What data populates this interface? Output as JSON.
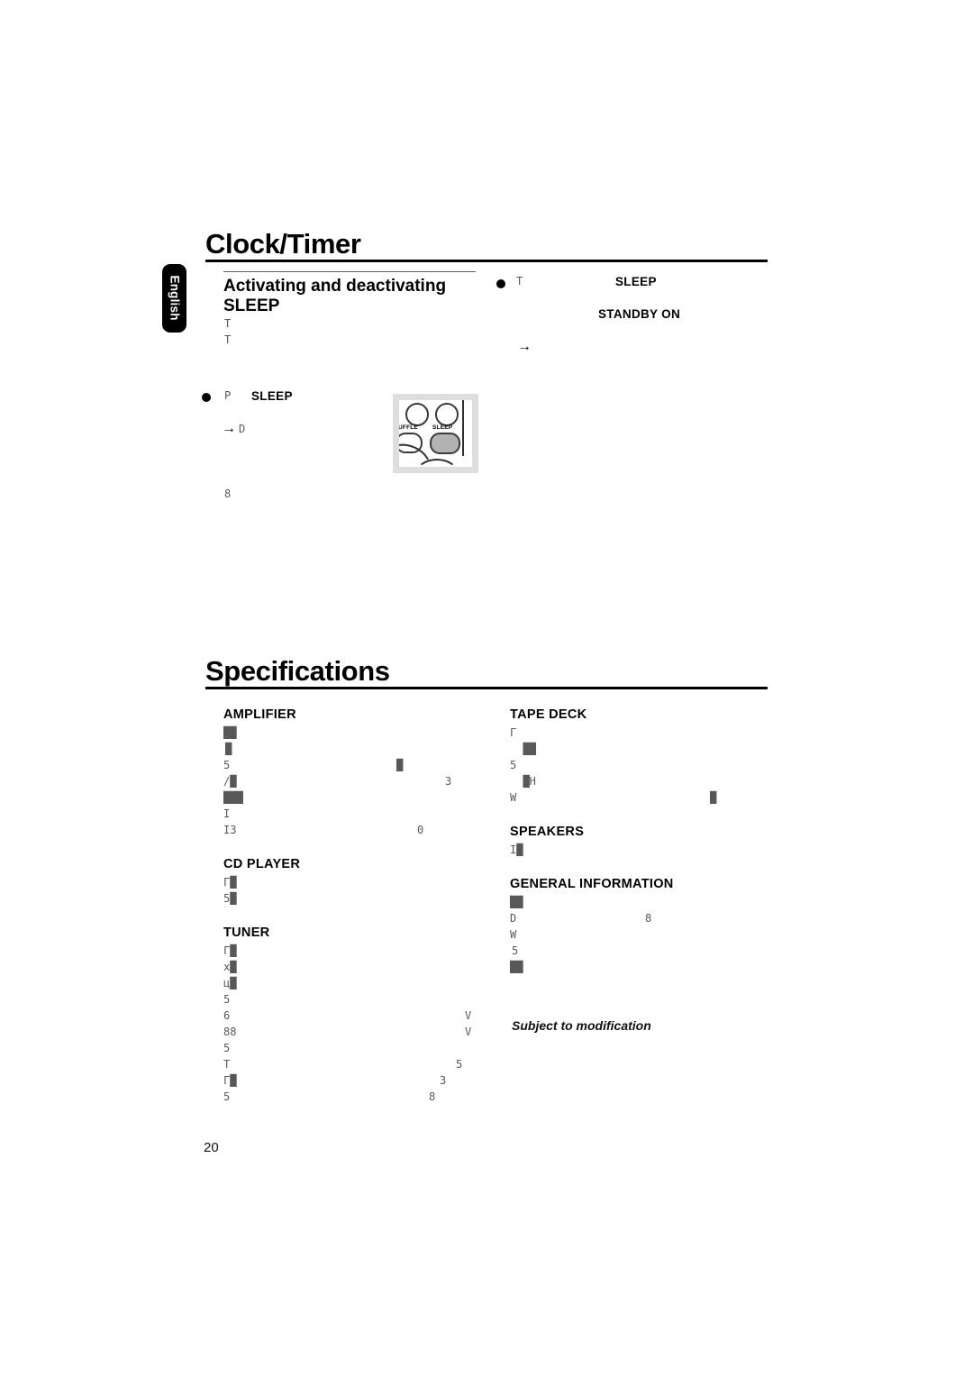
{
  "page": {
    "number": "20",
    "language_tab": "English"
  },
  "chapters": [
    {
      "title": "Clock/Timer"
    },
    {
      "title": "Specifications"
    }
  ],
  "clock_timer": {
    "section_heading_line1": "Activating and deactivating",
    "section_heading_line2": "SLEEP",
    "body_fragments_left": [
      "T",
      "T"
    ],
    "bullets": [
      {
        "glyph": "P",
        "bold_label": "SLEEP",
        "sub_arrow": "→",
        "sub_fragment": "D"
      }
    ],
    "trailing_fragment": "8",
    "right_column": {
      "bullet_glyph": "T",
      "bold_label_1": "SLEEP",
      "bold_label_2": "STANDBY ON",
      "arrow": "→"
    }
  },
  "remote_figure": {
    "label_left": "UFFLE",
    "label_right": "SLEEP"
  },
  "specifications": {
    "columns": [
      {
        "id": "left",
        "blocks": [
          {
            "heading": "AMPLIFIER",
            "rows": [
              {
                "left": "██",
                "mid": "",
                "right": ""
              },
              {
                "left": "█",
                "mid": "",
                "right": ""
              },
              {
                "left": "5",
                "mid": "█",
                "right": ""
              },
              {
                "left": "/█",
                "mid": "",
                "right": "3"
              },
              {
                "left": "███",
                "mid": "",
                "right": ""
              },
              {
                "left": "I",
                "mid": "",
                "right": ""
              },
              {
                "left": "I3",
                "mid": "0",
                "right": ""
              }
            ]
          },
          {
            "heading": "CD PLAYER",
            "rows": [
              {
                "left": "Г█",
                "mid": "",
                "right": ""
              },
              {
                "left": "5█",
                "mid": "",
                "right": ""
              }
            ]
          },
          {
            "heading": "TUNER",
            "rows": [
              {
                "left": "Г█",
                "mid": "",
                "right": ""
              },
              {
                "left": "х█",
                "mid": "",
                "right": ""
              },
              {
                "left": "ц█",
                "mid": "",
                "right": ""
              },
              {
                "left": "5",
                "mid": "",
                "right": ""
              },
              {
                "left": "6",
                "mid": "",
                "right": "V"
              },
              {
                "left": "88",
                "mid": "",
                "right": "V"
              },
              {
                "left": "5",
                "mid": "",
                "right": ""
              },
              {
                "left": "T",
                "mid": "",
                "right": "5"
              },
              {
                "left": "Г█",
                "mid": "",
                "right": "3"
              },
              {
                "left": "5",
                "mid": "8",
                "right": ""
              }
            ]
          }
        ]
      },
      {
        "id": "right",
        "blocks": [
          {
            "heading": "TAPE DECK",
            "rows": [
              {
                "left": "Г",
                "mid": "",
                "right": ""
              },
              {
                "left": "  ██",
                "mid": "",
                "right": ""
              },
              {
                "left": "5",
                "mid": "",
                "right": ""
              },
              {
                "left": "  █Η",
                "mid": "",
                "right": ""
              },
              {
                "left": "W",
                "mid": "",
                "right": "█"
              }
            ]
          },
          {
            "heading": "SPEAKERS",
            "rows": [
              {
                "left": "I█",
                "mid": "",
                "right": ""
              }
            ]
          },
          {
            "heading": "GENERAL INFORMATION",
            "rows": [
              {
                "left": "██",
                "mid": "",
                "right": ""
              },
              {
                "left": "D",
                "mid": "8",
                "right": ""
              },
              {
                "left": "W",
                "mid": "",
                "right": ""
              },
              {
                "left": "5",
                "mid": "",
                "right": ""
              },
              {
                "left": "██",
                "mid": "",
                "right": ""
              }
            ]
          }
        ]
      }
    ],
    "footnote": "Subject to modification"
  }
}
